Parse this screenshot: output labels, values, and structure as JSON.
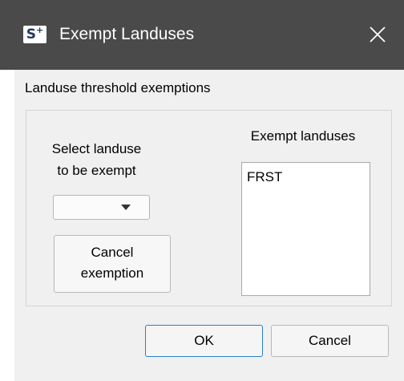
{
  "window": {
    "title": "Exempt Landuses",
    "app_icon": {
      "glyph": "S",
      "superscript": "+",
      "name": "sixpack-app-icon"
    },
    "close_icon": "close-icon"
  },
  "main": {
    "section_label": "Landuse threshold exemptions",
    "select_label_line1": "Select landuse",
    "select_label_line2": "to be exempt",
    "combo": {
      "value": ""
    },
    "cancel_exemption_line1": "Cancel",
    "cancel_exemption_line2": "exemption",
    "exempt_label": "Exempt landuses",
    "exempt_items": [
      "FRST"
    ]
  },
  "footer": {
    "ok_label": "OK",
    "cancel_label": "Cancel"
  },
  "colors": {
    "titlebar": "#4a4a4a",
    "client": "#f0f0f0",
    "ok_border": "#2b7fd3"
  }
}
